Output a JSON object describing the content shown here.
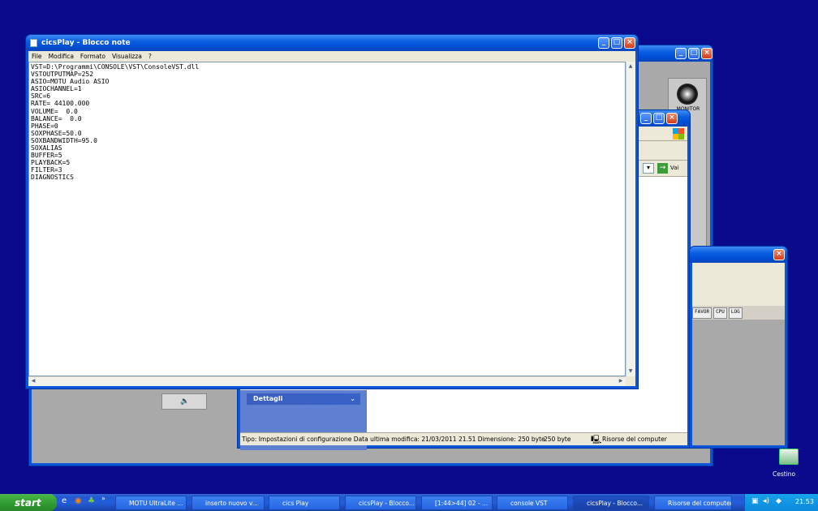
{
  "notepad": {
    "title": "cicsPlay - Blocco note",
    "menu": [
      "File",
      "Modifica",
      "Formato",
      "Visualizza",
      "?"
    ],
    "lines": [
      "VST=D:\\Programmi\\CONSOLE\\VST\\ConsoleVST.dll",
      "VSTOUTPUTMAP=252",
      "ASIO=MOTU Audio ASIO",
      "ASIOCHANNEL=1",
      "SRC=6",
      "RATE= 44100.000",
      "VOLUME=  0.0",
      "BALANCE=  0.0",
      "PHASE=0",
      "SOXPHASE=50.0",
      "SOXBANDWIDTH=95.0",
      "SOXALIAS",
      "BUFFER=5",
      "PLAYBACK=5",
      "FILTER=3",
      "DIAGNOSTICS"
    ]
  },
  "explorer": {
    "go_label": "Vai",
    "details_label": "Dettagli",
    "status": {
      "info": "Tipo: Impostazioni di configurazione Data ultima modifica: 21/03/2011 21.51 Dimensione: 250 byte",
      "size": "250 byte",
      "location": "Risorse del computer"
    }
  },
  "console": {
    "monitor_label": "MONITOR",
    "toolbar": [
      "FAVOR",
      "CPU",
      "LOG"
    ]
  },
  "desktop": {
    "recycle_label": "Cestino"
  },
  "taskbar": {
    "start_label": "start",
    "tasks": [
      "MOTU UltraLite ...",
      "inserto nuovo v...",
      "cics Play",
      "cicsPlay - Blocco...",
      "[1:44>44] 02 - ...",
      "console VST",
      "cicsPlay - Blocco...",
      "Risorse del computer"
    ],
    "clock": "21.53"
  }
}
